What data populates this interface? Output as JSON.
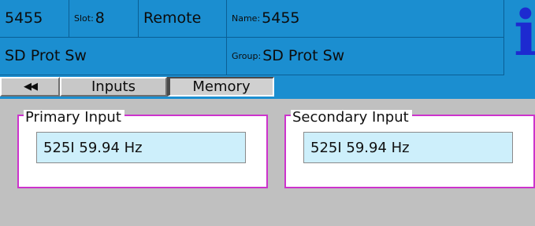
{
  "header": {
    "card_id": "5455",
    "slot_label": "Slot:",
    "slot_value": "8",
    "mode": "Remote",
    "name_label": "Name:",
    "name_value": "5455",
    "function": "SD Prot Sw",
    "group_label": "Group:",
    "group_value": "SD Prot Sw",
    "info_icon": "i"
  },
  "tabs": {
    "back_icon": "◀◀",
    "items": [
      {
        "label": "Inputs"
      },
      {
        "label": "Memory",
        "active": true
      }
    ]
  },
  "panels": {
    "primary": {
      "title": "Primary Input",
      "value": "525I 59.94 Hz"
    },
    "secondary": {
      "title": "Secondary Input",
      "value": "525I 59.94 Hz"
    }
  },
  "colors": {
    "header_blue": "#1b8ed0",
    "panel_border": "#cc33cc",
    "field_bg": "#cdeffb",
    "background": "#c0c0c0"
  }
}
